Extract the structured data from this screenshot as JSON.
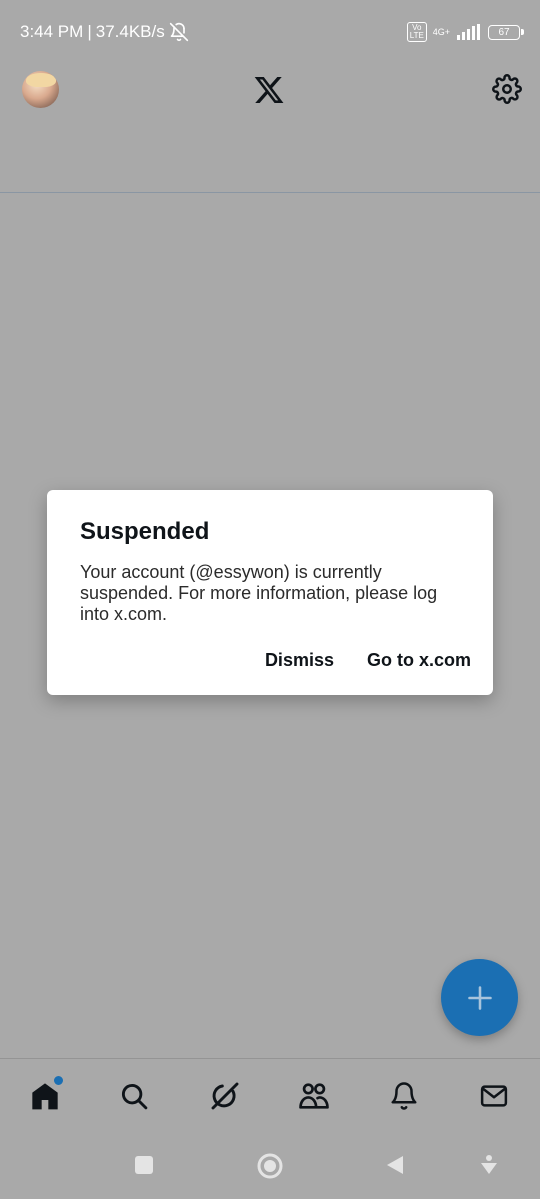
{
  "status_bar": {
    "time": "3:44 PM",
    "separator": "|",
    "speed": "37.4KB/s",
    "volte": "Vo LTE",
    "network": "4G+",
    "battery": "67",
    "icons": [
      "bell-off-icon",
      "volte-icon",
      "signal-icon",
      "battery-icon"
    ]
  },
  "header": {
    "avatar": "user-avatar",
    "logo": "x-logo-icon",
    "settings": "gear-icon"
  },
  "dialog": {
    "title": "Suspended",
    "message": "Your account (@essywon) is currently suspended. For more information, please log into x.com.",
    "dismiss_label": "Dismiss",
    "go_label": "Go to x.com"
  },
  "fab": {
    "icon": "plus-icon"
  },
  "bottom_nav": {
    "items": [
      {
        "name": "home",
        "icon": "home-icon",
        "has_badge": true
      },
      {
        "name": "search",
        "icon": "search-icon"
      },
      {
        "name": "grok",
        "icon": "grok-icon"
      },
      {
        "name": "communities",
        "icon": "communities-icon"
      },
      {
        "name": "notifications",
        "icon": "bell-icon"
      },
      {
        "name": "messages",
        "icon": "mail-icon"
      }
    ]
  },
  "colors": {
    "overlay_bg": "#a9a9a9",
    "accent": "#1b6fb3",
    "dialog_bg": "#ffffff",
    "text": "#0f1419"
  }
}
